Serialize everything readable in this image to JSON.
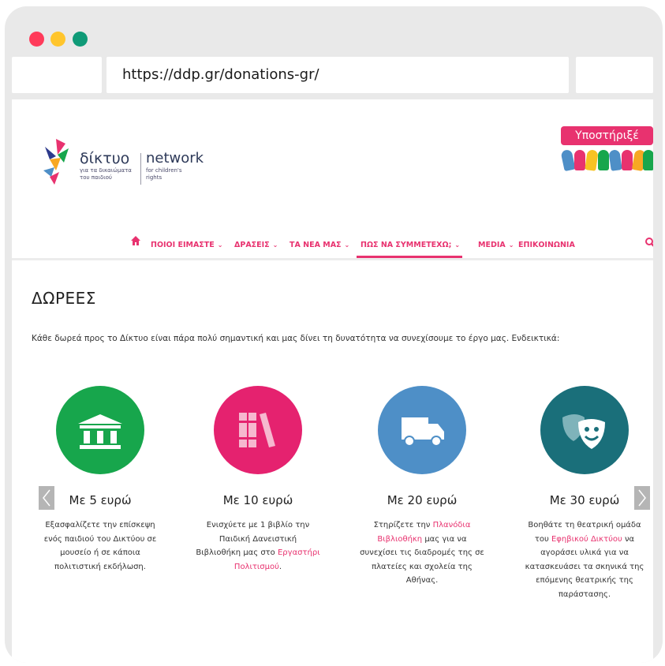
{
  "browser": {
    "url": "https://ddp.gr/donations-gr/"
  },
  "logo": {
    "line1": "δίκτυο",
    "line2": "για τα δικαιώματα",
    "line3": "του παιδιού",
    "line4": "network",
    "line5": "for children's",
    "line6": "rights"
  },
  "support": {
    "label": "Υποστήριξέ μας!"
  },
  "nav": {
    "items": [
      {
        "label": "ΠΟΙΟΙ ΕΙΜΑΣΤΕ"
      },
      {
        "label": "ΔΡΑΣΕΙΣ"
      },
      {
        "label": "ΤΑ ΝΕΑ ΜΑΣ"
      },
      {
        "label": "ΠΩΣ ΝΑ ΣΥΜΜΕΤΕΧΩ;"
      },
      {
        "label": "MEDIA"
      },
      {
        "label": "ΕΠΙΚΟΙΝΩΝΙΑ"
      }
    ],
    "chevron": "⌄"
  },
  "page": {
    "title": "ΔΩΡΕΕΣ",
    "intro": "Κάθε δωρεά προς το Δίκτυο είναι πάρα πολύ σημαντική και μας δίνει τη δυνατότητα να συνεχίσουμε το έργο μας. Ενδεικτικά:"
  },
  "cards": [
    {
      "amount": "Με 5 ευρώ",
      "color": "#17a64c",
      "icon": "museum-icon",
      "lines": [
        "Εξασφαλίζετε την επίσκεψη",
        "ενός παιδιού του Δικτύου σε",
        "μουσείο ή σε κάποια",
        "πολιτιστική εκδήλωση."
      ]
    },
    {
      "amount": "Με 10 ευρώ",
      "color": "#e5226f",
      "icon": "books-icon",
      "lines": [
        "Ενισχύετε με 1 βιβλίο την",
        "Παιδική Δανειστική",
        "Βιβλιοθήκη μας στο "
      ],
      "link1": "Εργαστήρι",
      "link2": "Πολιτισμού",
      "after": "."
    },
    {
      "amount": "Με 20 ευρώ",
      "color": "#4e8fc7",
      "icon": "truck-icon",
      "pre": "Στηρίζετε την ",
      "link1": "Πλανόδια",
      "link2": "Βιβλιοθήκη",
      "post": " μας για να",
      "lines": [
        "συνεχίσει τις διαδρομές της σε",
        "πλατείες και σχολεία της",
        "Αθήνας."
      ]
    },
    {
      "amount": "Με 30 ευρώ",
      "color": "#1a6f7a",
      "icon": "theater-masks-icon",
      "line1": "Βοηθάτε τη θεατρική ομάδα",
      "pre": "του ",
      "link": "Εφηβικού Δικτύου",
      "post": " να",
      "lines": [
        "αγοράσει υλικά για να",
        "κατασκευάσει τα σκηνικά της",
        "επόμενης θεατρικής της",
        "παράστασης."
      ]
    }
  ],
  "colors": {
    "accent": "#e8326f"
  }
}
